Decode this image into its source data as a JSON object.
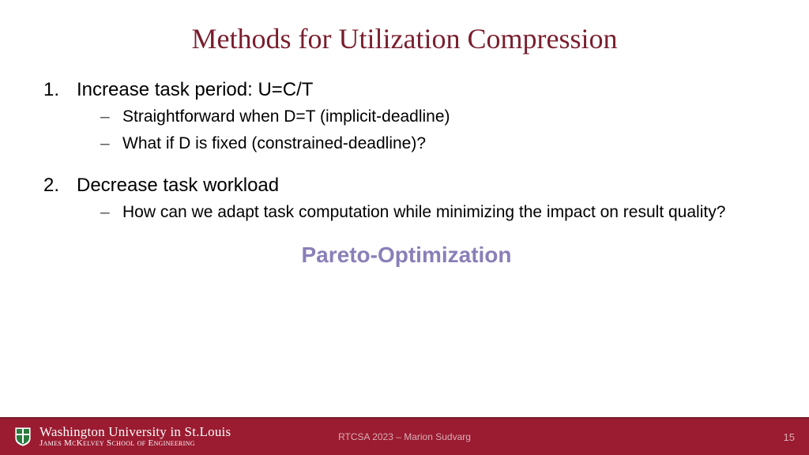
{
  "title": "Methods for Utilization Compression",
  "items": [
    {
      "num": "1.",
      "text": "Increase task period: U=C/T",
      "subs": [
        "Straightforward when D=T (implicit-deadline)",
        "What if D is fixed (constrained-deadline)?"
      ]
    },
    {
      "num": "2.",
      "text": "Decrease task workload",
      "subs": [
        "How can we adapt task computation while minimizing the impact on result quality?"
      ]
    }
  ],
  "highlight": "Pareto-Optimization",
  "footer": {
    "university": "Washington University in St.Louis",
    "school": "James McKelvey School of Engineering",
    "center": "RTCSA 2023 – Marion Sudvarg",
    "page": "15"
  }
}
